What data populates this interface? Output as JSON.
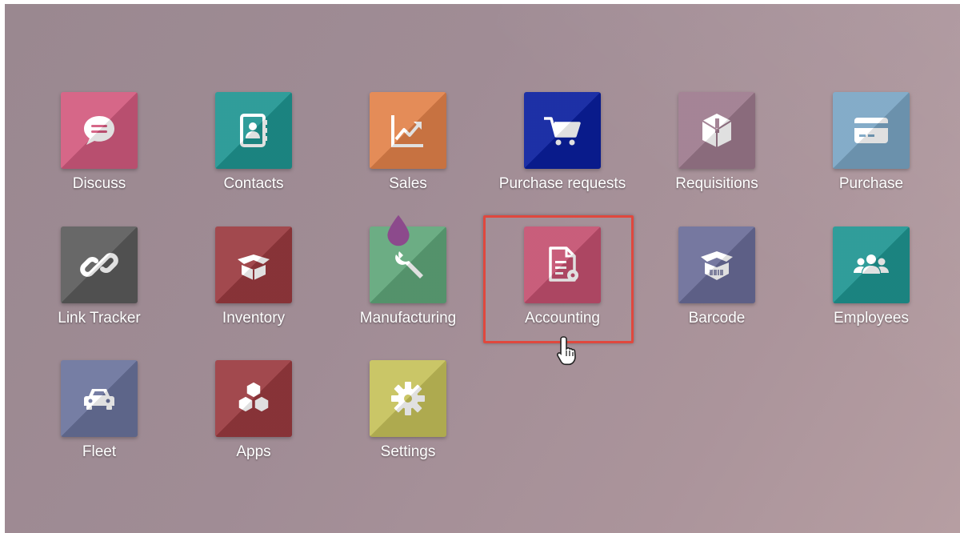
{
  "apps": [
    {
      "label": "Discuss",
      "icon": "chat-bubble-icon",
      "color": "#d25a7e"
    },
    {
      "label": "Contacts",
      "icon": "address-book-icon",
      "color": "#1f9591"
    },
    {
      "label": "Sales",
      "icon": "trending-chart-icon",
      "color": "#e2824a"
    },
    {
      "label": "Purchase requests",
      "icon": "shopping-cart-icon",
      "color": "#0a1f9e"
    },
    {
      "label": "Requisitions",
      "icon": "package-alert-icon",
      "color": "#9d7a8d"
    },
    {
      "label": "Purchase",
      "icon": "credit-card-icon",
      "color": "#7aa5c4"
    },
    {
      "label": "Link Tracker",
      "icon": "link-icon",
      "color": "#5b5b5b"
    },
    {
      "label": "Inventory",
      "icon": "open-box-icon",
      "color": "#9a3a3f"
    },
    {
      "label": "Manufacturing",
      "icon": "wrench-drop-icon",
      "color": "#5fa67a"
    },
    {
      "label": "Accounting",
      "icon": "invoice-gear-icon",
      "color": "#c45070"
    },
    {
      "label": "Barcode",
      "icon": "barcode-box-icon",
      "color": "#6a6c98"
    },
    {
      "label": "Employees",
      "icon": "people-group-icon",
      "color": "#1f9591"
    },
    {
      "label": "Fleet",
      "icon": "car-icon",
      "color": "#6a739c"
    },
    {
      "label": "Apps",
      "icon": "cubes-icon",
      "color": "#9a3a3f"
    },
    {
      "label": "Settings",
      "icon": "gear-icon",
      "color": "#c6c15a"
    }
  ],
  "highlighted_app": "Accounting",
  "highlight_color": "#e0483e"
}
